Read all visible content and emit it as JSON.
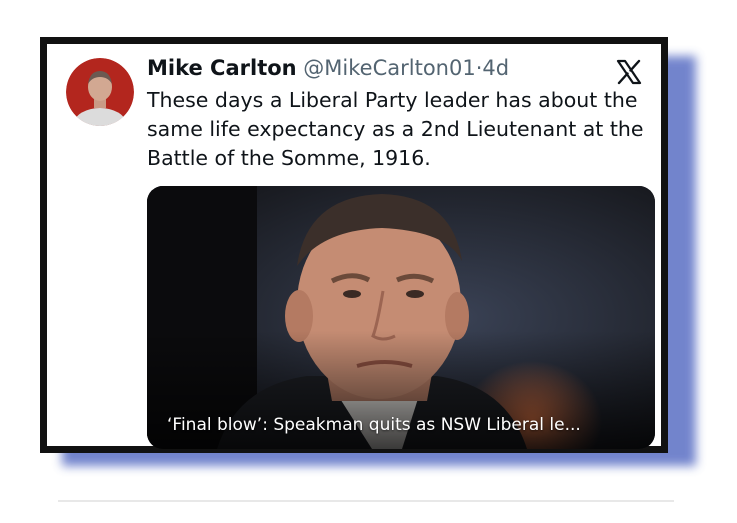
{
  "tweet": {
    "display_name": "Mike Carlton",
    "handle": "@MikeCarlton01",
    "separator": "·",
    "time": "4d",
    "text": "These days a Liberal Party leader has about the same life expectancy as a 2nd Lieutenant at the Battle of the Somme, 1916.",
    "platform_icon": "x-logo-icon",
    "avatar_icon": "avatar-photo",
    "media": {
      "caption": "‘Final blow’: Speakman quits as NSW Liberal le..."
    }
  },
  "colors": {
    "card_border": "#111111",
    "shadow": "#5a6fc4",
    "text_primary": "#0f1419",
    "text_secondary": "#536471"
  }
}
